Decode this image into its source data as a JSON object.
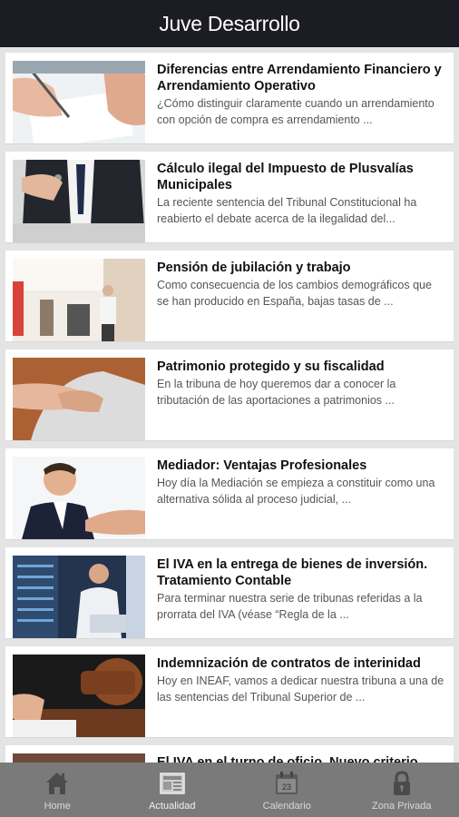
{
  "header": {
    "title": "Juve Desarrollo"
  },
  "articles": [
    {
      "title": "Diferencias entre Arrendamiento Financiero y Arrendamiento Operativo",
      "excerpt": "¿Cómo distinguir claramente cuando un arrendamiento con opción de compra es arrendamiento ..."
    },
    {
      "title": "Cálculo ilegal del Impuesto de Plusvalías Municipales",
      "excerpt": "La reciente sentencia del Tribunal Constitucional ha reabierto el debate acerca de la ilegalidad del..."
    },
    {
      "title": "Pensión de jubilación y trabajo",
      "excerpt": "  Como consecuencia de los cambios demográficos que se han producido en España, bajas tasas de ..."
    },
    {
      "title": "Patrimonio protegido y su fiscalidad",
      "excerpt": "En la tribuna de hoy queremos dar a conocer la tributación de las aportaciones a patrimonios ..."
    },
    {
      "title": "Mediador: Ventajas Profesionales",
      "excerpt": "Hoy día la Mediación se empieza a constituir como una alternativa sólida al proceso judicial, ..."
    },
    {
      "title": "El IVA en la entrega de bienes de inversión. Tratamiento Contable",
      "excerpt": "Para terminar nuestra serie de tribunas referidas a la prorrata del IVA (véase “Regla de la ..."
    },
    {
      "title": "Indemnización de contratos de interinidad",
      "excerpt": "Hoy en INEAF, vamos a dedicar nuestra tribuna a una de las sentencias del Tribunal Superior de ..."
    },
    {
      "title": "El IVA en el turno de oficio. Nuevo criterio",
      "excerpt": ""
    }
  ],
  "tabs": [
    {
      "label": "Home",
      "icon": "home-icon"
    },
    {
      "label": "Actualidad",
      "icon": "news-icon"
    },
    {
      "label": "Calendario",
      "icon": "calendar-icon",
      "day": "23"
    },
    {
      "label": "Zona Privada",
      "icon": "lock-icon"
    }
  ],
  "colors": {
    "header_bg": "#1c1c24",
    "tabbar_bg": "#7a7a7a",
    "page_bg": "#e4e4e4"
  }
}
